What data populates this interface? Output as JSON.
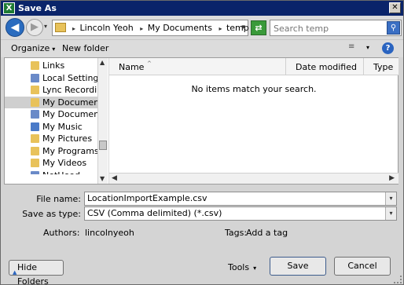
{
  "window": {
    "title": "Save As",
    "app_icon": "X",
    "close_glyph": "✕"
  },
  "nav": {
    "back_glyph": "◀",
    "forward_glyph": "▶",
    "history_glyph": "▾",
    "breadcrumbs": [
      "Lincoln Yeoh",
      "My Documents",
      "temp"
    ],
    "crumb_sep": "▸",
    "address_dd": "▾",
    "refresh_glyph": "⇄",
    "search_placeholder": "Search temp",
    "search_glyph": "⚲"
  },
  "toolbar": {
    "organize_label": "Organize",
    "organize_arrow": "▾",
    "new_folder_label": "New folder",
    "views_glyph": "≡",
    "views_dd": "▾",
    "help_glyph": "?"
  },
  "sidebar": {
    "items": [
      {
        "label": "Links",
        "icon": "folder-icon",
        "color": "#e8c25a"
      },
      {
        "label": "Local Settings",
        "icon": "shortcut-icon",
        "color": "#6a8ac8"
      },
      {
        "label": "Lync Recordings",
        "icon": "folder-icon",
        "color": "#e8c25a"
      },
      {
        "label": "My Documents",
        "icon": "folder-icon",
        "color": "#e8c25a",
        "selected": true
      },
      {
        "label": "My Documents",
        "icon": "shortcut-icon",
        "color": "#6a8ac8"
      },
      {
        "label": "My Music",
        "icon": "music-folder-icon",
        "color": "#4a7ac8"
      },
      {
        "label": "My Pictures",
        "icon": "pictures-folder-icon",
        "color": "#e8c25a"
      },
      {
        "label": "My Programs",
        "icon": "folder-icon",
        "color": "#e8c25a"
      },
      {
        "label": "My Videos",
        "icon": "videos-folder-icon",
        "color": "#e8c25a"
      },
      {
        "label": "NetHood",
        "icon": "shortcut-icon",
        "color": "#6a8ac8"
      }
    ],
    "scroll_up": "▲",
    "scroll_down": "▼"
  },
  "files": {
    "columns": [
      {
        "label": "Name"
      },
      {
        "label": "Date modified"
      },
      {
        "label": "Type"
      }
    ],
    "sort_glyph": "^",
    "empty_message": "No items match your search.",
    "hscroll_left": "◀",
    "hscroll_right": "▶"
  },
  "form": {
    "file_name_label": "File name:",
    "file_name_value": "LocationImportExample.csv",
    "save_type_label": "Save as type:",
    "save_type_value": "CSV (Comma delimited) (*.csv)",
    "dd_glyph": "▾"
  },
  "meta": {
    "authors_label": "Authors:",
    "authors_value": "lincolnyeoh",
    "tags_label": "Tags:",
    "tags_value": "Add a tag"
  },
  "footer": {
    "hide_folders_label": "Hide Folders",
    "hide_folders_glyph": "▲",
    "tools_label": "Tools",
    "tools_arrow": "▾",
    "save_label": "Save",
    "cancel_label": "Cancel"
  }
}
